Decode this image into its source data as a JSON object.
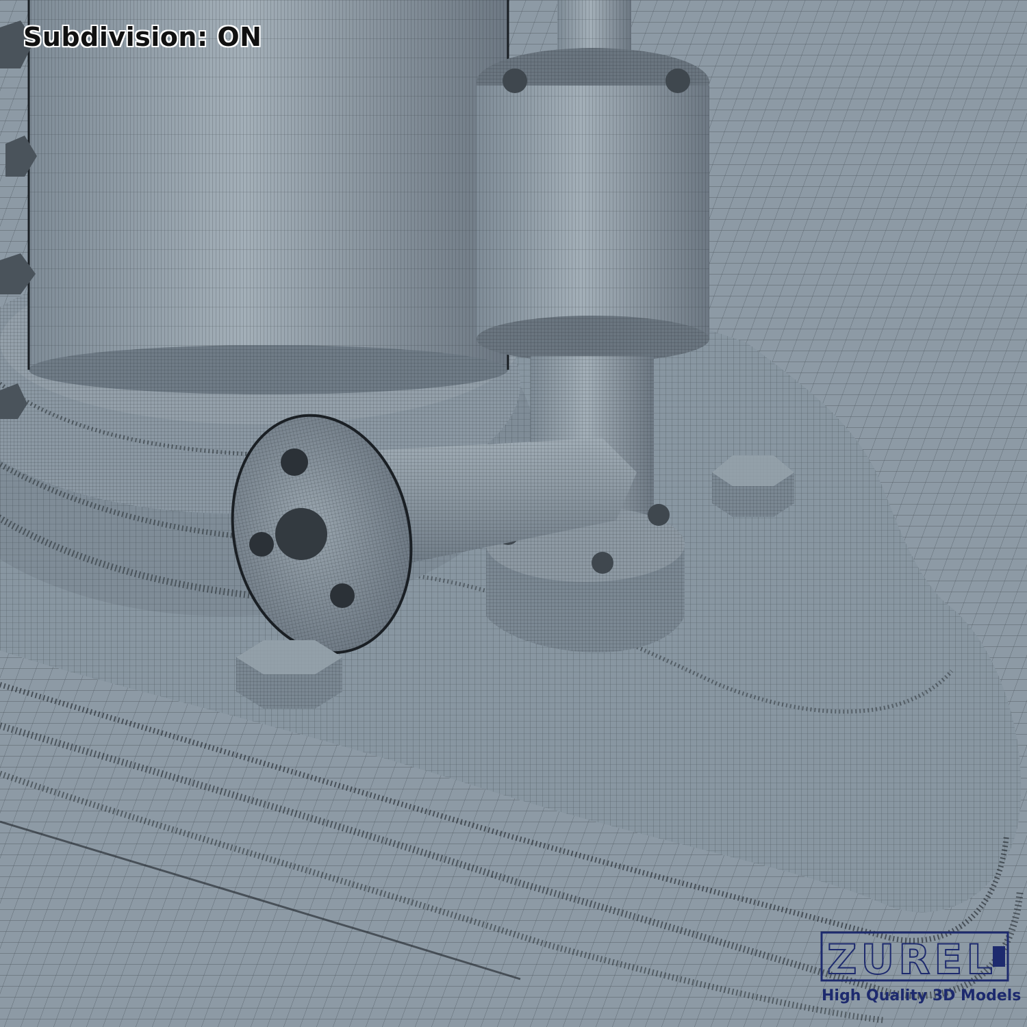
{
  "overlay": {
    "subdivision_label": "Subdivision: ON"
  },
  "watermark": {
    "logo_text": "ZUREL",
    "tagline": "High Quality 3D Models",
    "color": "#1d2a6e"
  },
  "scene": {
    "description_kind": "wireframe-render",
    "surface_color": "#8d9aa5",
    "wire_color": "#1a1f24"
  }
}
